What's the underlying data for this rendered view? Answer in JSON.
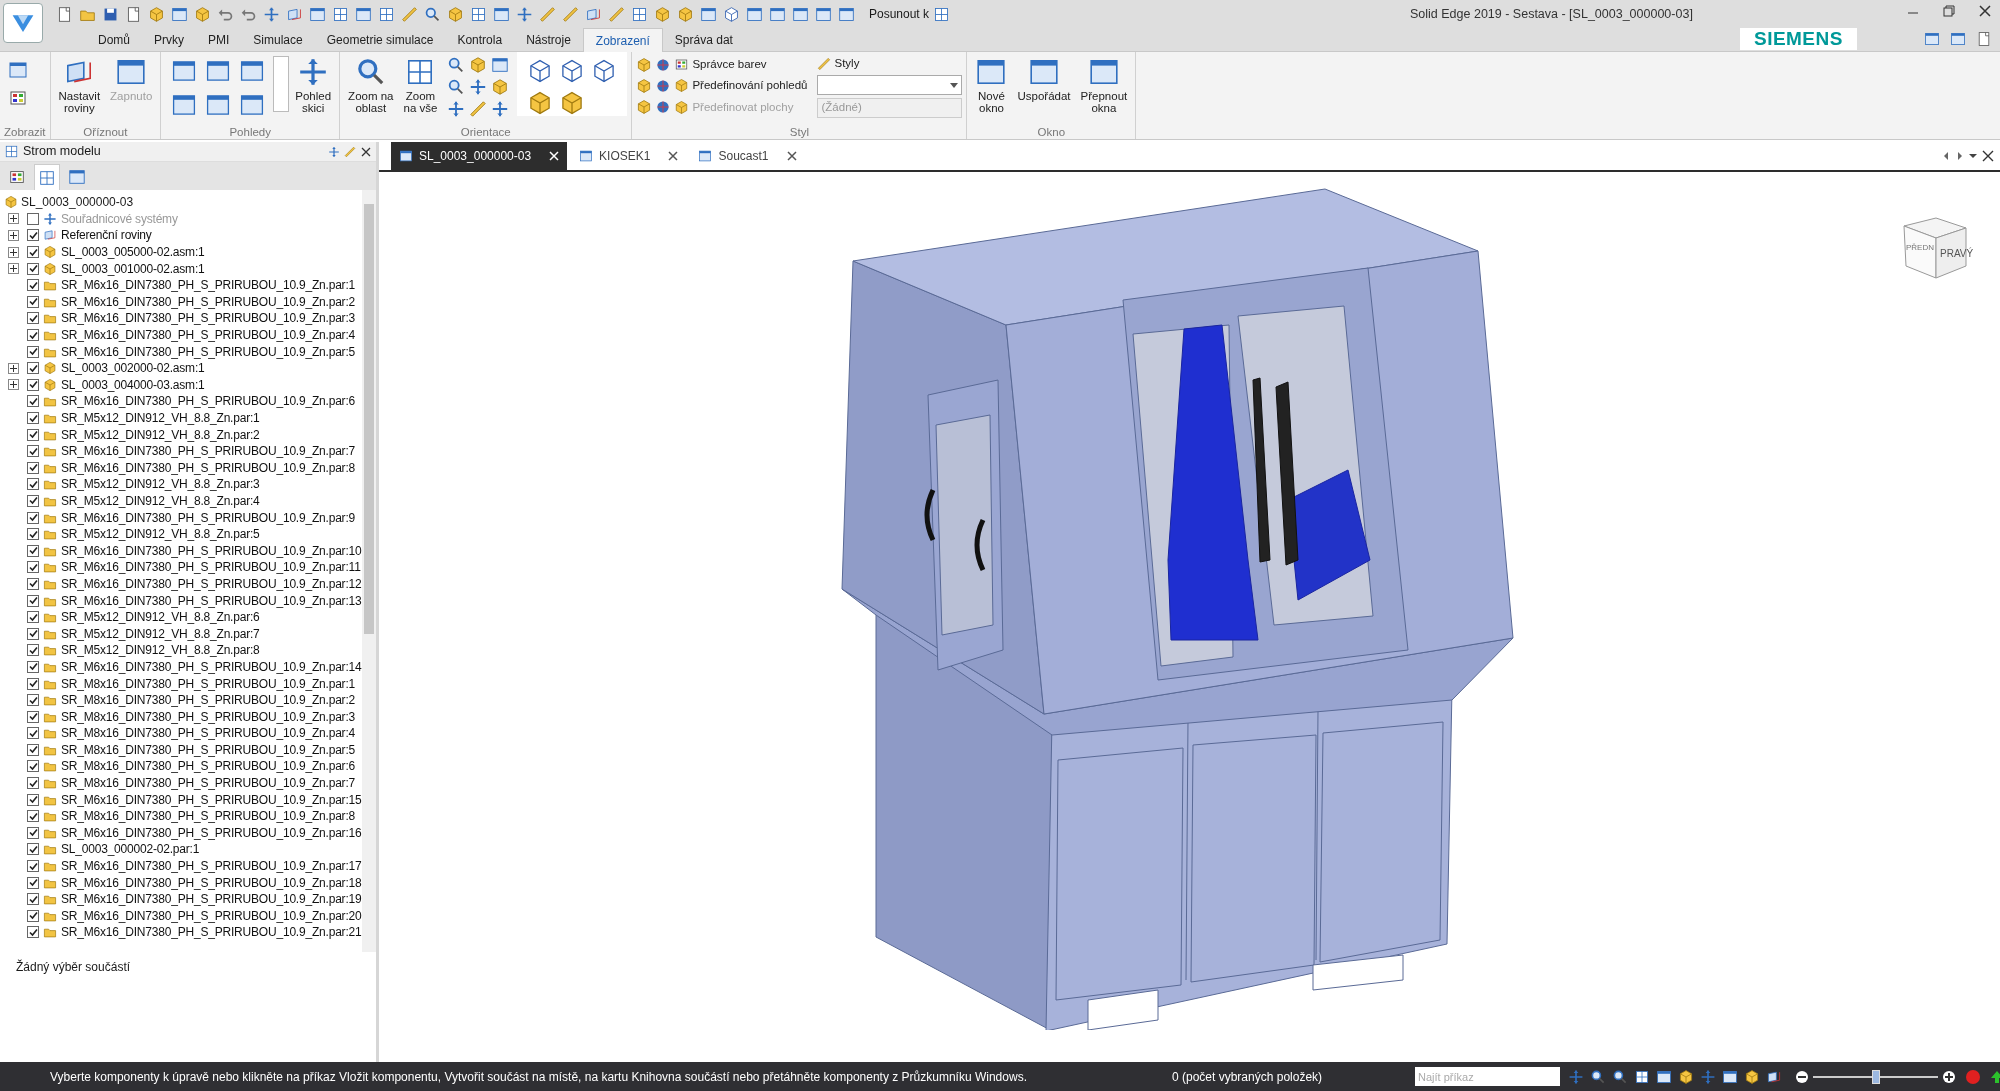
{
  "window": {
    "title": "Solid Edge 2019 - Sestava - [SL_0003_000000-03]",
    "quick_access_label": "Posunout k",
    "brand": "SIEMENS"
  },
  "ribbon_tabs": [
    {
      "label": "Domů",
      "selected": false
    },
    {
      "label": "Prvky",
      "selected": false
    },
    {
      "label": "PMI",
      "selected": false
    },
    {
      "label": "Simulace",
      "selected": false
    },
    {
      "label": "Geometrie simulace",
      "selected": false
    },
    {
      "label": "Kontrola",
      "selected": false
    },
    {
      "label": "Nástroje",
      "selected": false
    },
    {
      "label": "Zobrazení",
      "selected": true
    },
    {
      "label": "Správa dat",
      "selected": false
    }
  ],
  "ribbon_groups": [
    {
      "name": "Zobrazit",
      "kind": "small_icons"
    },
    {
      "name": "Oříznout",
      "kind": "large",
      "buttons": [
        {
          "lines": [
            "Nastavit",
            "roviny"
          ],
          "disabled": false
        },
        {
          "lines": [
            "Zapnuto"
          ],
          "disabled": true
        }
      ]
    },
    {
      "name": "Pohledy",
      "kind": "views",
      "buttons": [
        {
          "lines": [
            "Pohled",
            "skici"
          ],
          "disabled": false
        }
      ]
    },
    {
      "name": "Orientace",
      "kind": "large",
      "buttons": [
        {
          "lines": [
            "Zoom na",
            "oblast"
          ],
          "disabled": false
        },
        {
          "lines": [
            "Zoom",
            "na vše"
          ],
          "disabled": false
        }
      ]
    },
    {
      "name": "Styl",
      "kind": "style",
      "buttons": [
        {
          "lines": [
            "Správce barev"
          ],
          "disabled": false
        },
        {
          "lines": [
            "Předefinování pohledů"
          ],
          "disabled": false
        },
        {
          "lines": [
            "Předefinovat plochy"
          ],
          "disabled": true
        }
      ],
      "styles_label": "Styly",
      "style_dropdown": {
        "disabled": false
      },
      "face_dropdown": {
        "value": "(Žádné)",
        "disabled": true
      }
    },
    {
      "name": "Okno",
      "kind": "large",
      "buttons": [
        {
          "lines": [
            "Nové",
            "okno"
          ],
          "disabled": false
        },
        {
          "lines": [
            "Uspořádat"
          ],
          "disabled": false
        },
        {
          "lines": [
            "Přepnout",
            "okna"
          ],
          "disabled": false
        }
      ]
    }
  ],
  "model_tree": {
    "title": "Strom modelu",
    "root": {
      "label": "SL_0003_000000-03",
      "children": [
        {
          "label": "Souřadnicové systémy",
          "kind": "coordinates",
          "checked": false,
          "expandable": true
        },
        {
          "label": "Referenční roviny",
          "kind": "planes",
          "checked": true,
          "expandable": true
        },
        {
          "label": "SL_0003_005000-02.asm:1",
          "kind": "assembly",
          "checked": true,
          "expandable": true
        },
        {
          "label": "SL_0003_001000-02.asm:1",
          "kind": "assembly",
          "checked": true,
          "expandable": true
        },
        {
          "label": "SR_M6x16_DIN7380_PH_S_PRIRUBOU_10.9_Zn.par:1",
          "kind": "part",
          "checked": true,
          "expandable": false
        },
        {
          "label": "SR_M6x16_DIN7380_PH_S_PRIRUBOU_10.9_Zn.par:2",
          "kind": "part",
          "checked": true,
          "expandable": false
        },
        {
          "label": "SR_M6x16_DIN7380_PH_S_PRIRUBOU_10.9_Zn.par:3",
          "kind": "part",
          "checked": true,
          "expandable": false
        },
        {
          "label": "SR_M6x16_DIN7380_PH_S_PRIRUBOU_10.9_Zn.par:4",
          "kind": "part",
          "checked": true,
          "expandable": false
        },
        {
          "label": "SR_M6x16_DIN7380_PH_S_PRIRUBOU_10.9_Zn.par:5",
          "kind": "part",
          "checked": true,
          "expandable": false
        },
        {
          "label": "SL_0003_002000-02.asm:1",
          "kind": "assembly",
          "checked": true,
          "expandable": true
        },
        {
          "label": "SL_0003_004000-03.asm:1",
          "kind": "assembly",
          "checked": true,
          "expandable": true
        },
        {
          "label": "SR_M6x16_DIN7380_PH_S_PRIRUBOU_10.9_Zn.par:6",
          "kind": "part",
          "checked": true,
          "expandable": false
        },
        {
          "label": "SR_M5x12_DIN912_VH_8.8_Zn.par:1",
          "kind": "part",
          "checked": true,
          "expandable": false
        },
        {
          "label": "SR_M5x12_DIN912_VH_8.8_Zn.par:2",
          "kind": "part",
          "checked": true,
          "expandable": false
        },
        {
          "label": "SR_M6x16_DIN7380_PH_S_PRIRUBOU_10.9_Zn.par:7",
          "kind": "part",
          "checked": true,
          "expandable": false
        },
        {
          "label": "SR_M6x16_DIN7380_PH_S_PRIRUBOU_10.9_Zn.par:8",
          "kind": "part",
          "checked": true,
          "expandable": false
        },
        {
          "label": "SR_M5x12_DIN912_VH_8.8_Zn.par:3",
          "kind": "part",
          "checked": true,
          "expandable": false
        },
        {
          "label": "SR_M5x12_DIN912_VH_8.8_Zn.par:4",
          "kind": "part",
          "checked": true,
          "expandable": false
        },
        {
          "label": "SR_M6x16_DIN7380_PH_S_PRIRUBOU_10.9_Zn.par:9",
          "kind": "part",
          "checked": true,
          "expandable": false
        },
        {
          "label": "SR_M5x12_DIN912_VH_8.8_Zn.par:5",
          "kind": "part",
          "checked": true,
          "expandable": false
        },
        {
          "label": "SR_M6x16_DIN7380_PH_S_PRIRUBOU_10.9_Zn.par:10",
          "kind": "part",
          "checked": true,
          "expandable": false
        },
        {
          "label": "SR_M6x16_DIN7380_PH_S_PRIRUBOU_10.9_Zn.par:11",
          "kind": "part",
          "checked": true,
          "expandable": false
        },
        {
          "label": "SR_M6x16_DIN7380_PH_S_PRIRUBOU_10.9_Zn.par:12",
          "kind": "part",
          "checked": true,
          "expandable": false
        },
        {
          "label": "SR_M6x16_DIN7380_PH_S_PRIRUBOU_10.9_Zn.par:13",
          "kind": "part",
          "checked": true,
          "expandable": false
        },
        {
          "label": "SR_M5x12_DIN912_VH_8.8_Zn.par:6",
          "kind": "part",
          "checked": true,
          "expandable": false
        },
        {
          "label": "SR_M5x12_DIN912_VH_8.8_Zn.par:7",
          "kind": "part",
          "checked": true,
          "expandable": false
        },
        {
          "label": "SR_M5x12_DIN912_VH_8.8_Zn.par:8",
          "kind": "part",
          "checked": true,
          "expandable": false
        },
        {
          "label": "SR_M6x16_DIN7380_PH_S_PRIRUBOU_10.9_Zn.par:14",
          "kind": "part",
          "checked": true,
          "expandable": false
        },
        {
          "label": "SR_M8x16_DIN7380_PH_S_PRIRUBOU_10.9_Zn.par:1",
          "kind": "part",
          "checked": true,
          "expandable": false
        },
        {
          "label": "SR_M8x16_DIN7380_PH_S_PRIRUBOU_10.9_Zn.par:2",
          "kind": "part",
          "checked": true,
          "expandable": false
        },
        {
          "label": "SR_M8x16_DIN7380_PH_S_PRIRUBOU_10.9_Zn.par:3",
          "kind": "part",
          "checked": true,
          "expandable": false
        },
        {
          "label": "SR_M8x16_DIN7380_PH_S_PRIRUBOU_10.9_Zn.par:4",
          "kind": "part",
          "checked": true,
          "expandable": false
        },
        {
          "label": "SR_M8x16_DIN7380_PH_S_PRIRUBOU_10.9_Zn.par:5",
          "kind": "part",
          "checked": true,
          "expandable": false
        },
        {
          "label": "SR_M8x16_DIN7380_PH_S_PRIRUBOU_10.9_Zn.par:6",
          "kind": "part",
          "checked": true,
          "expandable": false
        },
        {
          "label": "SR_M8x16_DIN7380_PH_S_PRIRUBOU_10.9_Zn.par:7",
          "kind": "part",
          "checked": true,
          "expandable": false
        },
        {
          "label": "SR_M6x16_DIN7380_PH_S_PRIRUBOU_10.9_Zn.par:15",
          "kind": "part",
          "checked": true,
          "expandable": false
        },
        {
          "label": "SR_M8x16_DIN7380_PH_S_PRIRUBOU_10.9_Zn.par:8",
          "kind": "part",
          "checked": true,
          "expandable": false
        },
        {
          "label": "SR_M6x16_DIN7380_PH_S_PRIRUBOU_10.9_Zn.par:16",
          "kind": "part",
          "checked": true,
          "expandable": false
        },
        {
          "label": "SL_0003_000002-02.par:1",
          "kind": "part",
          "checked": true,
          "expandable": false
        },
        {
          "label": "SR_M6x16_DIN7380_PH_S_PRIRUBOU_10.9_Zn.par:17",
          "kind": "part",
          "checked": true,
          "expandable": false
        },
        {
          "label": "SR_M6x16_DIN7380_PH_S_PRIRUBOU_10.9_Zn.par:18",
          "kind": "part",
          "checked": true,
          "expandable": false
        },
        {
          "label": "SR_M6x16_DIN7380_PH_S_PRIRUBOU_10.9_Zn.par:19",
          "kind": "part",
          "checked": true,
          "expandable": false
        },
        {
          "label": "SR_M6x16_DIN7380_PH_S_PRIRUBOU_10.9_Zn.par:20",
          "kind": "part",
          "checked": true,
          "expandable": false
        },
        {
          "label": "SR_M6x16_DIN7380_PH_S_PRIRUBOU_10.9_Zn.par:21",
          "kind": "part",
          "checked": true,
          "expandable": false
        }
      ]
    },
    "selection_info": "Žádný výběr součástí",
    "panel_tabs": [
      {
        "selected": false
      },
      {
        "selected": true
      },
      {
        "selected": false
      }
    ]
  },
  "document_tabs": [
    {
      "label": "SL_0003_000000-03",
      "selected": true
    },
    {
      "label": "KIOSEK1",
      "selected": false
    },
    {
      "label": "Soucast1",
      "selected": false
    }
  ],
  "view_cube": {
    "front": "PŘEDN",
    "right": "PRAVÝ"
  },
  "status_bar": {
    "message": "Vyberte komponenty k úpravě nebo klikněte na příkaz Vložit komponentu, Vytvořit součást na místě, na kartu Knihovna součástí nebo přetáhněte komponenty z Průzkumníku Windows.",
    "selection_count": "0 (počet vybraných položek)",
    "command_search": {
      "placeholder": "Najít příkaz"
    },
    "zoom_slider": {
      "level": 0.5
    }
  }
}
